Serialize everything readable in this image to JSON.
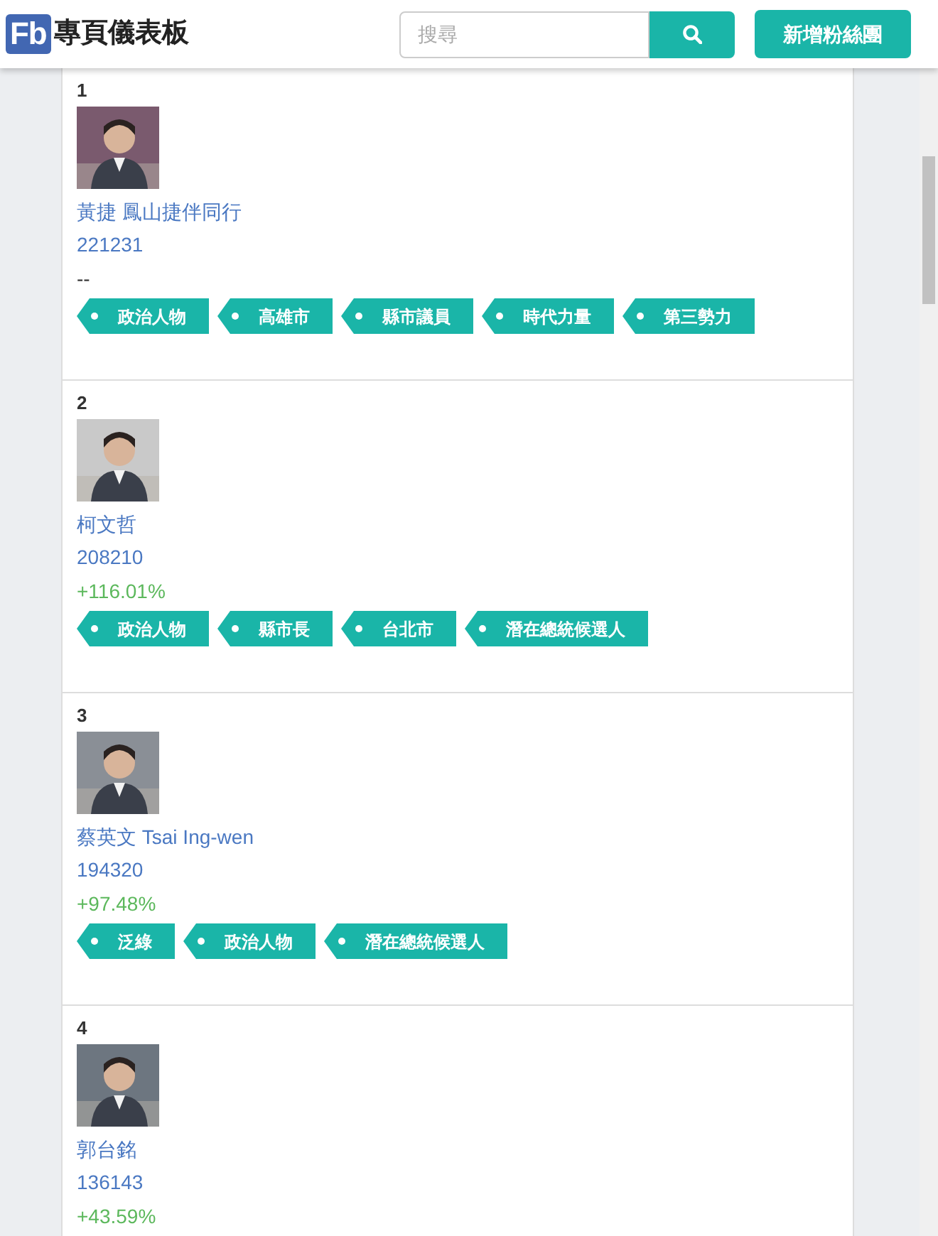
{
  "header": {
    "logo": "Fb",
    "title": "專頁儀表板",
    "search": {
      "placeholder": "搜尋"
    },
    "add_button": "新增粉絲團"
  },
  "pages": [
    {
      "rank": "1",
      "name": "黃捷 鳳山捷伴同行",
      "fans": "221231",
      "change": "--",
      "kind": "flat",
      "tags": [
        "政治人物",
        "高雄市",
        "縣市議員",
        "時代力量",
        "第三勢力"
      ]
    },
    {
      "rank": "2",
      "name": "柯文哲",
      "fans": "208210",
      "change": "+116.01%",
      "kind": "growth",
      "tags": [
        "政治人物",
        "縣市長",
        "台北市",
        "潛在總統候選人"
      ]
    },
    {
      "rank": "3",
      "name": "蔡英文 Tsai Ing-wen",
      "fans": "194320",
      "change": "+97.48%",
      "kind": "growth",
      "tags": [
        "泛綠",
        "政治人物",
        "潛在總統候選人"
      ]
    },
    {
      "rank": "4",
      "name": "郭台銘",
      "fans": "136143",
      "change": "+43.59%",
      "kind": "growth"
    }
  ]
}
